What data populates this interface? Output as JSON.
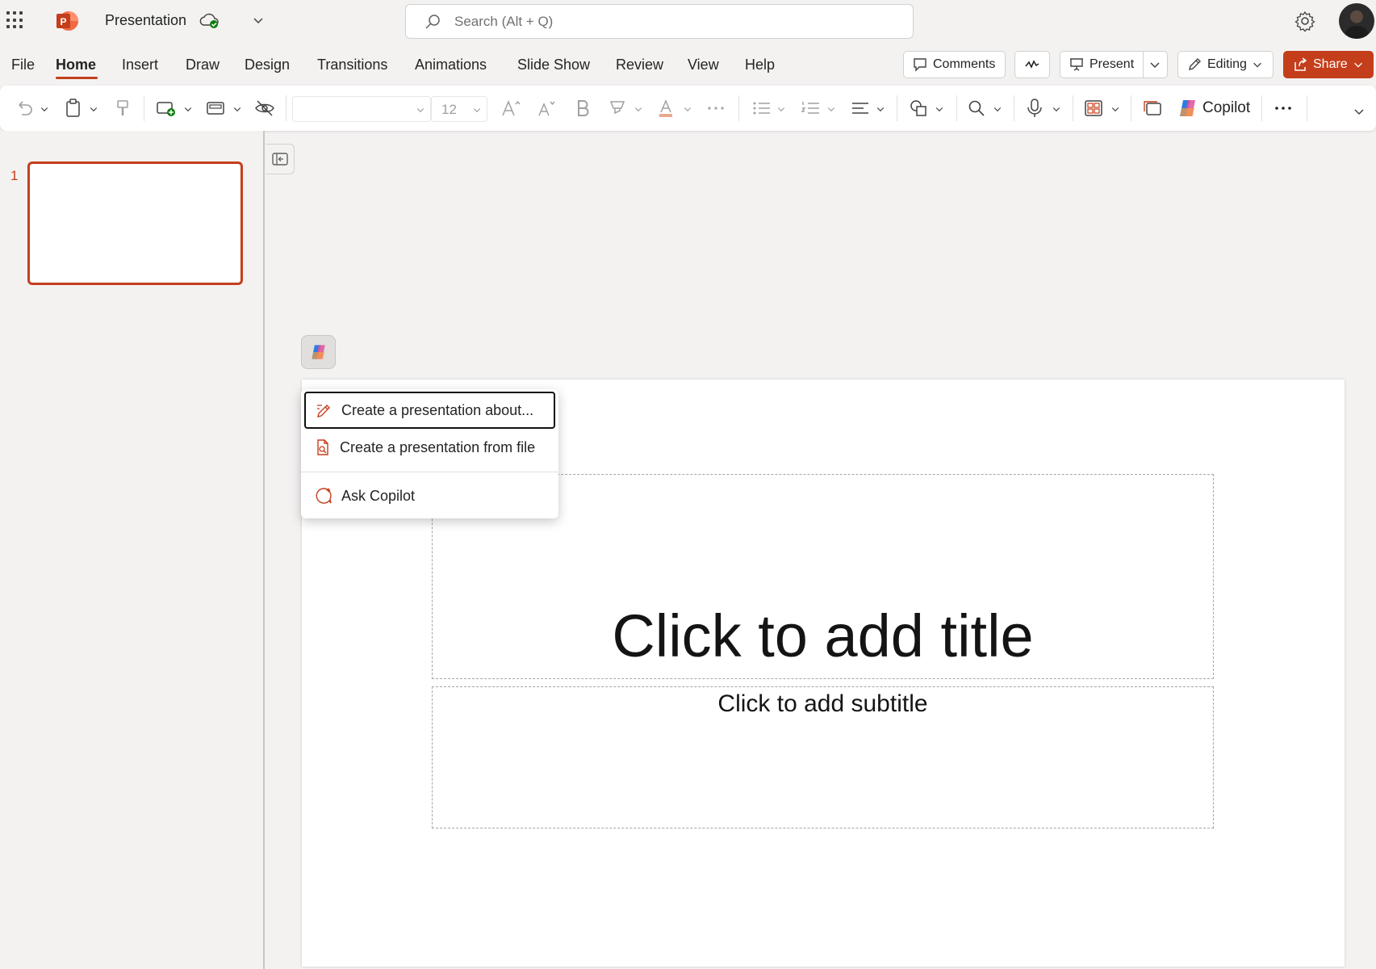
{
  "app": {
    "document_title": "Presentation",
    "search_placeholder": "Search (Alt + Q)"
  },
  "menu": {
    "items": [
      "File",
      "Home",
      "Insert",
      "Draw",
      "Design",
      "Transitions",
      "Animations",
      "Slide Show",
      "Review",
      "View",
      "Help"
    ],
    "active": "Home"
  },
  "header_buttons": {
    "comments": "Comments",
    "present": "Present",
    "editing": "Editing",
    "share": "Share"
  },
  "ribbon": {
    "font_size": "12",
    "copilot_label": "Copilot"
  },
  "slides_panel": {
    "slide_number": "1"
  },
  "slide": {
    "title_placeholder": "Click to add title",
    "subtitle_placeholder": "Click to add subtitle"
  },
  "copilot_menu": {
    "items": [
      {
        "label": "Create a presentation about...",
        "icon": "pencil-sparkle-icon"
      },
      {
        "label": "Create a presentation from file",
        "icon": "document-search-icon"
      },
      {
        "label": "Ask Copilot",
        "icon": "chat-sparkle-icon"
      }
    ]
  },
  "colors": {
    "brand": "#c43e1c",
    "background": "#f3f2f1",
    "ribbon": "#ffffff"
  }
}
